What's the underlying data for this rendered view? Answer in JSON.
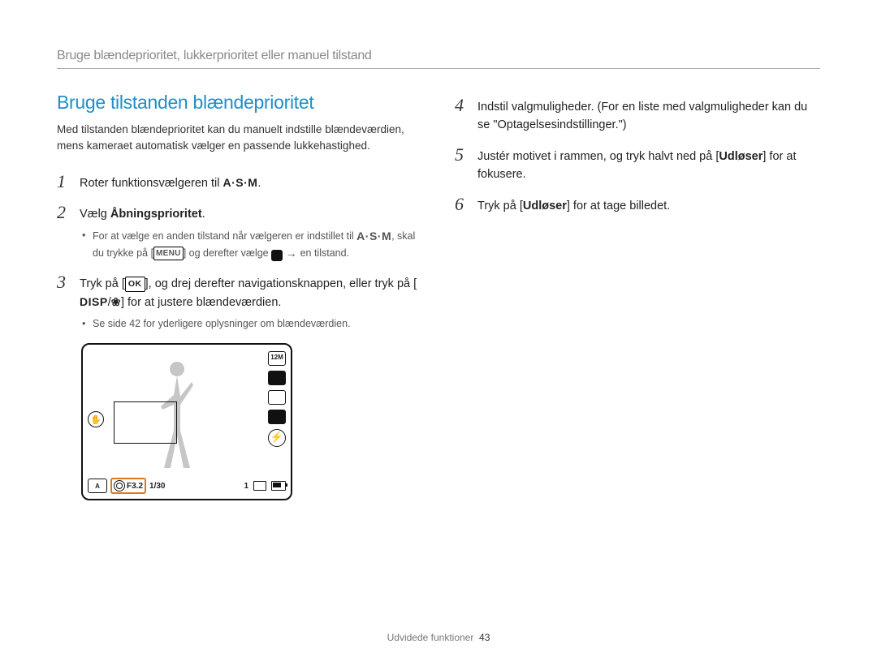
{
  "breadcrumb": "Bruge blændeprioritet, lukkerprioritet eller manuel tilstand",
  "section_title": "Bruge tilstanden blændeprioritet",
  "intro": "Med tilstanden blændeprioritet kan du manuelt indstille blændeværdien, mens kameraet automatisk vælger en passende lukkehastighed.",
  "icons": {
    "asm": "A·S·M",
    "menu": "MENU",
    "mode": "mode",
    "arrow": "→",
    "ok": "OK",
    "disp": "DISP",
    "flower": "❀"
  },
  "left_steps": [
    {
      "num": "1",
      "parts": [
        "Roter funktionsvælgeren til ",
        {
          "icon": "asm"
        },
        "."
      ]
    },
    {
      "num": "2",
      "parts": [
        "Vælg ",
        {
          "bold": "Åbningsprioritet"
        },
        "."
      ],
      "sub_parts": [
        "For at vælge en anden tilstand når vælgeren er indstillet til ",
        {
          "icon": "asm"
        },
        ", skal du trykke på [",
        {
          "icon": "menu"
        },
        "] og derefter vælge ",
        {
          "icon": "mode"
        },
        " ",
        {
          "icon": "arrow"
        },
        " en tilstand."
      ]
    },
    {
      "num": "3",
      "parts": [
        "Tryk på [",
        {
          "icon": "ok"
        },
        "], og drej derefter navigationsknappen, eller tryk på [",
        {
          "icon": "disp"
        },
        "/",
        {
          "icon": "flower"
        },
        "] for at justere blændeværdien."
      ],
      "sub_parts": [
        "Se side 42 for yderligere oplysninger om blændeværdien."
      ]
    }
  ],
  "right_steps": [
    {
      "num": "4",
      "parts": [
        "Indstil valgmuligheder. (For en liste med valgmuligheder kan du se \"Optagelsesindstillinger.\")"
      ]
    },
    {
      "num": "5",
      "parts": [
        "Justér motivet i rammen, og tryk halvt ned på [",
        {
          "bold": "Udløser"
        },
        "] for at fokusere."
      ]
    },
    {
      "num": "6",
      "parts": [
        "Tryk på [",
        {
          "bold": "Udløser"
        },
        "] for at tage billedet."
      ]
    }
  ],
  "camera_screen": {
    "right_icons": [
      "12M",
      "",
      "",
      "",
      ""
    ],
    "left_hand_icon": "✋",
    "flash_icon": "⚡",
    "f_value": "F3.2",
    "shutter": "1/30",
    "counter": "1"
  },
  "footer": {
    "label": "Udvidede funktioner",
    "page": "43"
  }
}
